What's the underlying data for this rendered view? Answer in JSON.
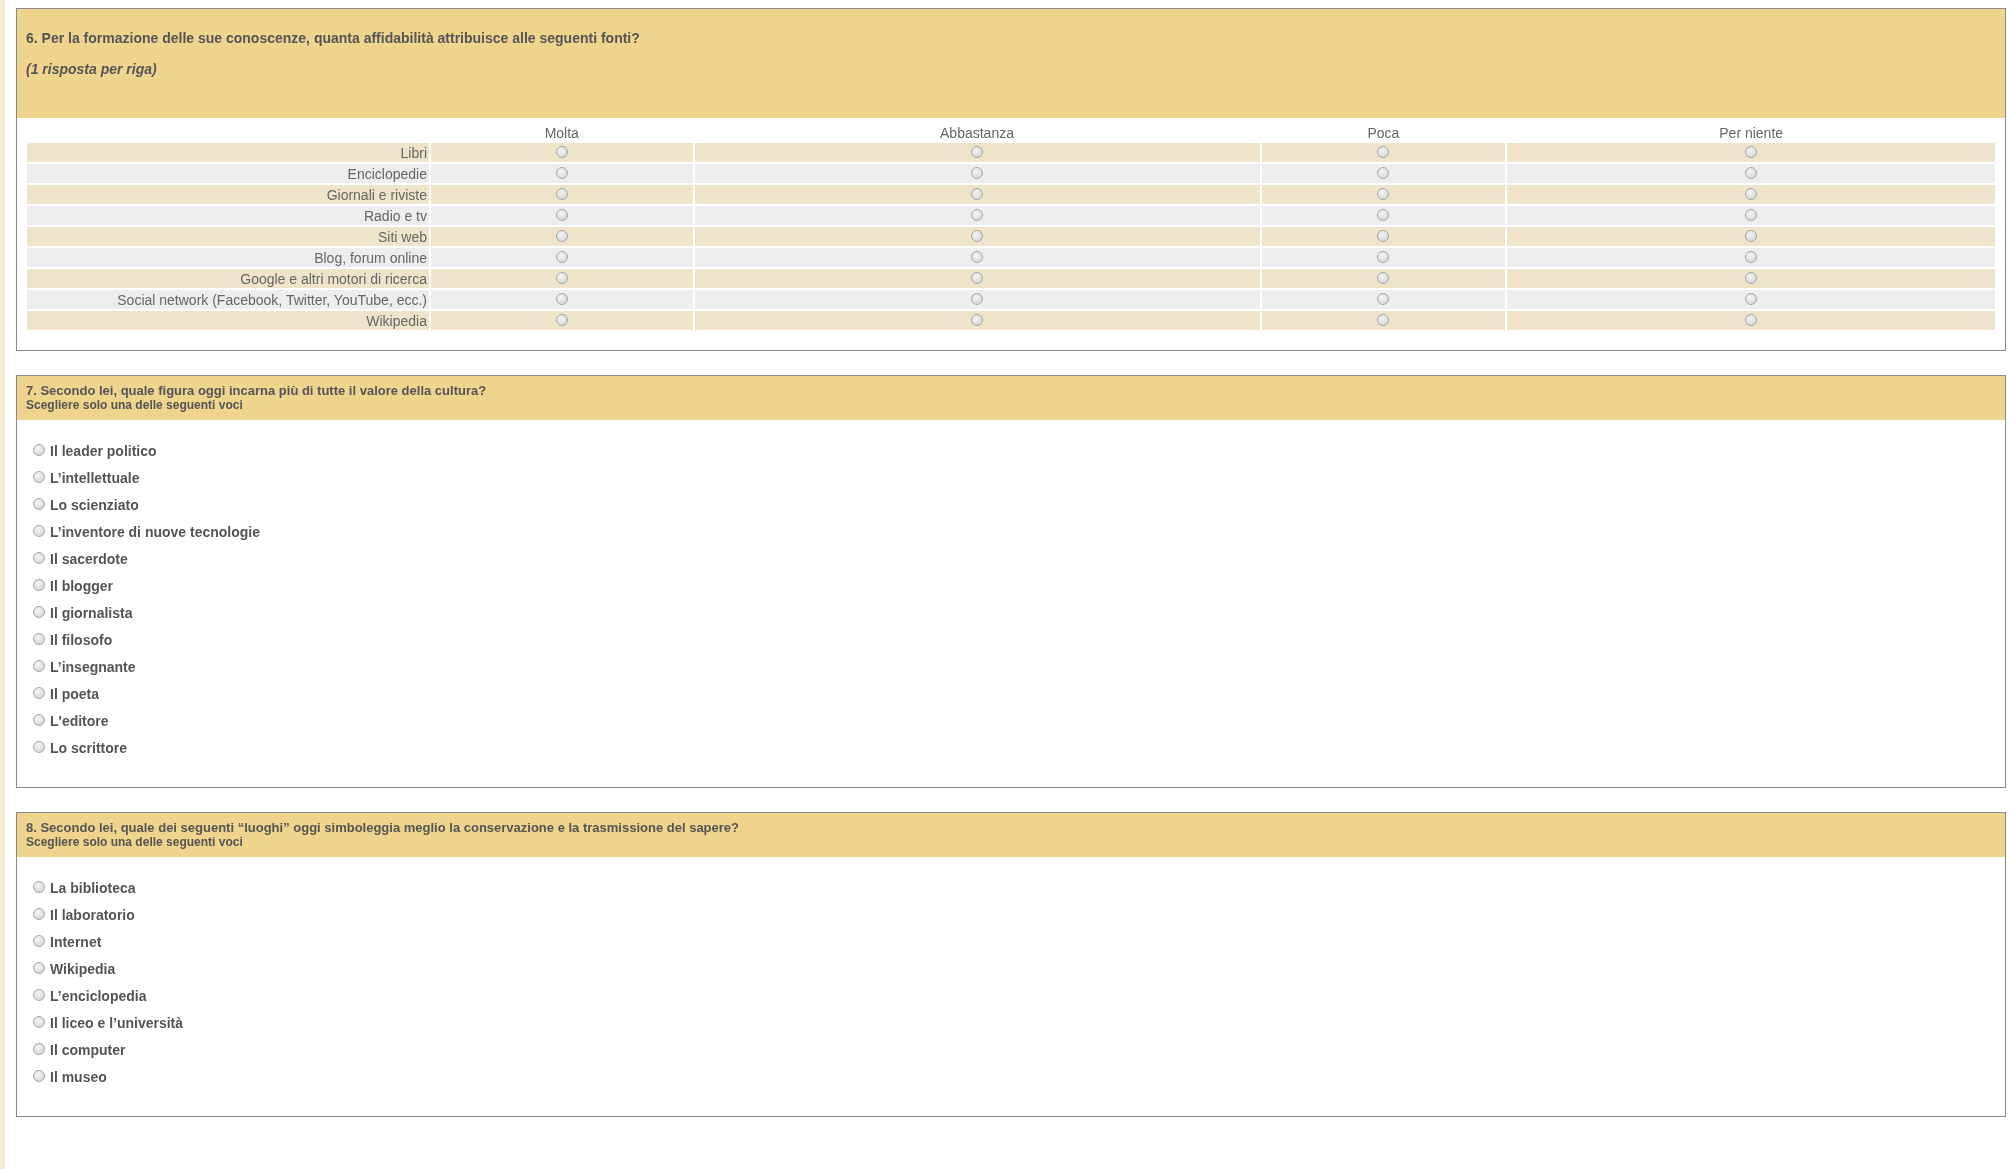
{
  "questions": [
    {
      "kind": "matrix",
      "title": "6. Per la formazione delle sue conoscenze, quanta affidabilità attribuisce alle seguenti fonti?",
      "note": "(1 risposta per riga)",
      "columns": [
        "Molta",
        "Abbastanza",
        "Poca",
        "Per niente"
      ],
      "rows": [
        {
          "label": "Libri",
          "cells": [
            {
              "selected": false
            },
            {
              "selected": false
            },
            {
              "selected": false
            },
            {
              "selected": false
            }
          ]
        },
        {
          "label": "Enciclopedie",
          "cells": [
            {
              "selected": false
            },
            {
              "selected": false
            },
            {
              "selected": false
            },
            {
              "selected": false
            }
          ]
        },
        {
          "label": "Giornali e riviste",
          "cells": [
            {
              "selected": false
            },
            {
              "selected": false
            },
            {
              "selected": false
            },
            {
              "selected": false
            }
          ]
        },
        {
          "label": "Radio e tv",
          "cells": [
            {
              "selected": false
            },
            {
              "selected": false
            },
            {
              "selected": false
            },
            {
              "selected": false
            }
          ]
        },
        {
          "label": "Siti web",
          "cells": [
            {
              "selected": false
            },
            {
              "selected": false
            },
            {
              "selected": false
            },
            {
              "selected": false
            }
          ]
        },
        {
          "label": "Blog, forum online",
          "cells": [
            {
              "selected": false
            },
            {
              "selected": false
            },
            {
              "selected": false
            },
            {
              "selected": false
            }
          ]
        },
        {
          "label": "Google e altri motori di ricerca",
          "cells": [
            {
              "selected": false
            },
            {
              "selected": false
            },
            {
              "selected": false
            },
            {
              "selected": false
            }
          ]
        },
        {
          "label": "Social network (Facebook, Twitter, YouTube, ecc.)",
          "cells": [
            {
              "selected": false
            },
            {
              "selected": false
            },
            {
              "selected": false
            },
            {
              "selected": false
            }
          ]
        },
        {
          "label": "Wikipedia",
          "cells": [
            {
              "selected": false
            },
            {
              "selected": false
            },
            {
              "selected": false
            },
            {
              "selected": false
            }
          ]
        }
      ]
    },
    {
      "kind": "single",
      "title": "7. Secondo lei, quale figura oggi incarna più di tutte il valore della cultura?",
      "note": "Scegliere solo una delle seguenti voci",
      "options": [
        {
          "label": "Il leader politico",
          "selected": false
        },
        {
          "label": "L’intellettuale",
          "selected": false
        },
        {
          "label": "Lo scienziato",
          "selected": false
        },
        {
          "label": "L’inventore di nuove tecnologie",
          "selected": false
        },
        {
          "label": "Il sacerdote",
          "selected": false
        },
        {
          "label": "Il blogger",
          "selected": false
        },
        {
          "label": "Il giornalista",
          "selected": false
        },
        {
          "label": "Il filosofo",
          "selected": false
        },
        {
          "label": "L’insegnante",
          "selected": false
        },
        {
          "label": "Il poeta",
          "selected": false
        },
        {
          "label": "L'editore",
          "selected": false
        },
        {
          "label": "Lo scrittore",
          "selected": false
        }
      ]
    },
    {
      "kind": "single",
      "title": "8. Secondo lei, quale dei seguenti “luoghi” oggi simboleggia meglio la conservazione e la trasmissione del sapere?",
      "note": "Scegliere solo una delle seguenti voci",
      "options": [
        {
          "label": "La biblioteca",
          "selected": false
        },
        {
          "label": "Il laboratorio",
          "selected": false
        },
        {
          "label": "Internet",
          "selected": false
        },
        {
          "label": "Wikipedia",
          "selected": false
        },
        {
          "label": "L’enciclopedia",
          "selected": false
        },
        {
          "label": "Il liceo e l’università",
          "selected": false
        },
        {
          "label": "Il computer",
          "selected": false
        },
        {
          "label": "Il museo",
          "selected": false
        }
      ]
    }
  ]
}
